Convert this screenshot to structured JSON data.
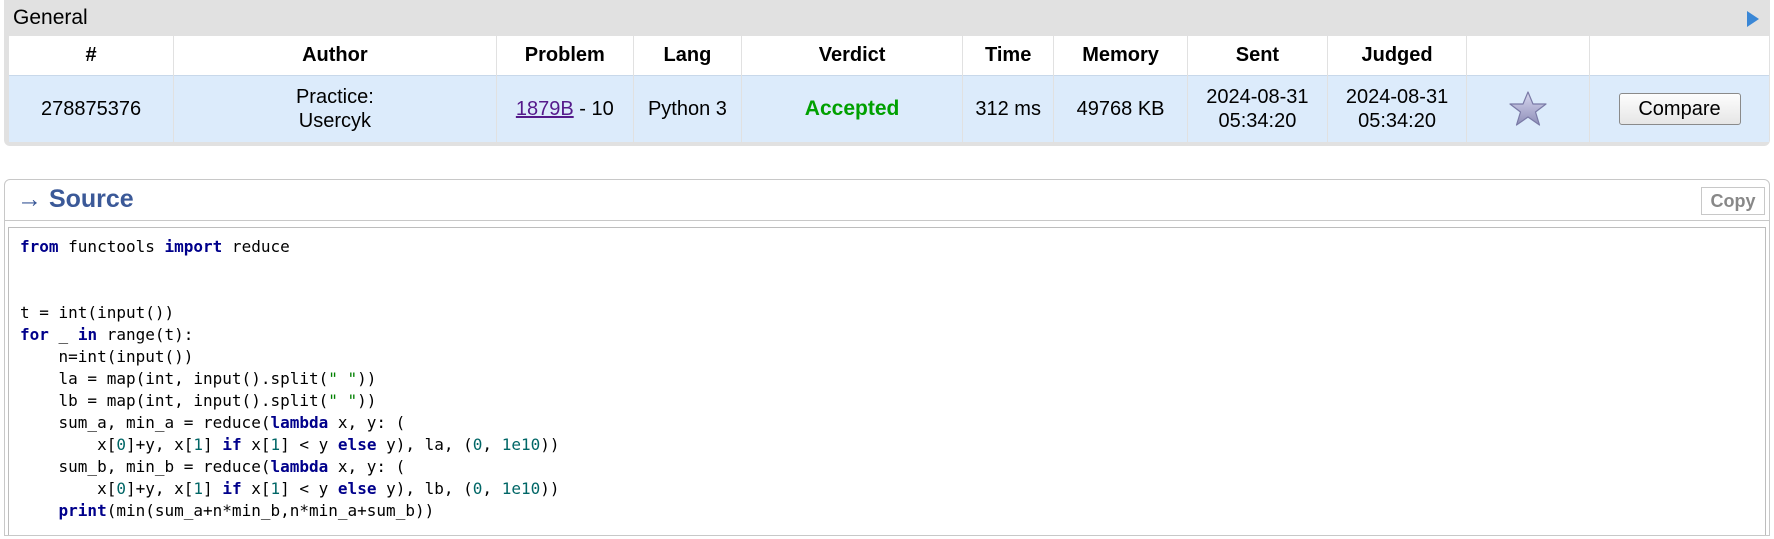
{
  "general": {
    "title": "General",
    "headers": [
      "#",
      "Author",
      "Problem",
      "Lang",
      "Verdict",
      "Time",
      "Memory",
      "Sent",
      "Judged",
      "",
      ""
    ],
    "row": {
      "id": "278875376",
      "author_line1": "Practice:",
      "author_line2": "Usercyk",
      "problem_link": "1879B",
      "problem_suffix": " - 10",
      "lang": "Python 3",
      "verdict": "Accepted",
      "time": "312 ms",
      "memory": "49768 KB",
      "sent_date": "2024-08-31",
      "sent_time": "05:34:20",
      "judged_date": "2024-08-31",
      "judged_time": "05:34:20",
      "compare_label": "Compare"
    },
    "icons": {
      "expand": "play-icon",
      "favorite": "star-icon"
    },
    "colors": {
      "header_bg": "#e1e1e1",
      "row_bg": "#dcebfb",
      "verdict": "#00a000",
      "link": "#551a8b"
    }
  },
  "source": {
    "title": "→ Source",
    "copy_label": "Copy",
    "code_lines": [
      [
        {
          "t": "from",
          "c": "kw"
        },
        {
          "t": " functools "
        },
        {
          "t": "import",
          "c": "kw"
        },
        {
          "t": " reduce"
        }
      ],
      [],
      [],
      [
        {
          "t": "t = int(input())"
        }
      ],
      [
        {
          "t": "for",
          "c": "kw"
        },
        {
          "t": " _ "
        },
        {
          "t": "in",
          "c": "kw"
        },
        {
          "t": " range(t):"
        }
      ],
      [
        {
          "t": "    n=int(input())"
        }
      ],
      [
        {
          "t": "    la = map(int, input().split("
        },
        {
          "t": "\" \"",
          "c": "str"
        },
        {
          "t": "))"
        }
      ],
      [
        {
          "t": "    lb = map(int, input().split("
        },
        {
          "t": "\" \"",
          "c": "str"
        },
        {
          "t": "))"
        }
      ],
      [
        {
          "t": "    sum_a, min_a = reduce("
        },
        {
          "t": "lambda",
          "c": "kw"
        },
        {
          "t": " x, y: ("
        }
      ],
      [
        {
          "t": "        x["
        },
        {
          "t": "0",
          "c": "num"
        },
        {
          "t": "]+y, x["
        },
        {
          "t": "1",
          "c": "num"
        },
        {
          "t": "] "
        },
        {
          "t": "if",
          "c": "kw"
        },
        {
          "t": " x["
        },
        {
          "t": "1",
          "c": "num"
        },
        {
          "t": "] < y "
        },
        {
          "t": "else",
          "c": "kw"
        },
        {
          "t": " y), la, ("
        },
        {
          "t": "0",
          "c": "num"
        },
        {
          "t": ", "
        },
        {
          "t": "1e10",
          "c": "num"
        },
        {
          "t": "))"
        }
      ],
      [
        {
          "t": "    sum_b, min_b = reduce("
        },
        {
          "t": "lambda",
          "c": "kw"
        },
        {
          "t": " x, y: ("
        }
      ],
      [
        {
          "t": "        x["
        },
        {
          "t": "0",
          "c": "num"
        },
        {
          "t": "]+y, x["
        },
        {
          "t": "1",
          "c": "num"
        },
        {
          "t": "] "
        },
        {
          "t": "if",
          "c": "kw"
        },
        {
          "t": " x["
        },
        {
          "t": "1",
          "c": "num"
        },
        {
          "t": "] < y "
        },
        {
          "t": "else",
          "c": "kw"
        },
        {
          "t": " y), lb, ("
        },
        {
          "t": "0",
          "c": "num"
        },
        {
          "t": ", "
        },
        {
          "t": "1e10",
          "c": "num"
        },
        {
          "t": "))"
        }
      ],
      [
        {
          "t": "    "
        },
        {
          "t": "print",
          "c": "kw"
        },
        {
          "t": "(min(sum_a+n*min_b,n*min_a+sum_b))"
        }
      ]
    ]
  }
}
